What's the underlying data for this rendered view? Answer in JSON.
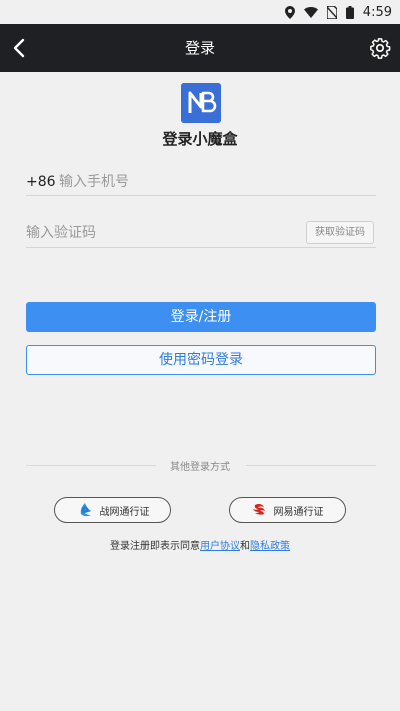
{
  "status_bar": {
    "time": "4:59",
    "icons": [
      "location-icon",
      "wifi-icon",
      "no-sim-icon",
      "battery-icon"
    ]
  },
  "app_bar": {
    "title": "登录",
    "back_icon": "chevron-left-icon",
    "settings_icon": "gear-icon"
  },
  "brand": {
    "logo_text": "NB",
    "title": "登录小魔盒"
  },
  "form": {
    "country_code": "+86",
    "phone_placeholder": "输入手机号",
    "phone_value": "",
    "code_placeholder": "输入验证码",
    "code_value": "",
    "get_code_label": "获取验证码"
  },
  "actions": {
    "login_label": "登录/注册",
    "password_login_label": "使用密码登录"
  },
  "other_login": {
    "label": "其他登录方式",
    "battlenet_label": "战网通行证",
    "netease_label": "网易通行证"
  },
  "agreement": {
    "prefix": "登录注册即表示同意",
    "user_agreement": "用户协议",
    "and": "和",
    "privacy_policy": "隐私政策"
  },
  "colors": {
    "primary": "#3d8ff2",
    "app_bar": "#1f2023",
    "background": "#f0f0f0",
    "logo": "#3b6fd8",
    "netease_red": "#d9261c"
  }
}
